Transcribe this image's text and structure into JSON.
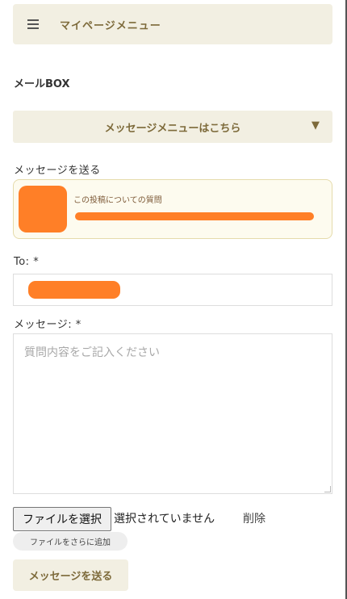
{
  "menu": {
    "title": "マイページメニュー",
    "icon": "hamburger-menu-icon"
  },
  "mailbox": {
    "heading": "メールBOX",
    "accordion_label": "メッセージメニューはこちら",
    "accordion_arrow": "▼"
  },
  "compose": {
    "send_heading": "メッセージを送る",
    "post_caption": "この投稿についての質問",
    "to_label": "To: *",
    "message_label": "メッセージ: *",
    "message_placeholder": "質問内容をご記入ください",
    "file_button_label": "ファイルを選択",
    "file_status": "選択されていません",
    "delete_label": "削除",
    "add_file_label": "ファイルをさらに追加",
    "send_button_label": "メッセージを送る"
  },
  "colors": {
    "accent_bg": "#f2efe2",
    "accent_text": "#7d6a3a",
    "redaction": "#ff7f27"
  }
}
